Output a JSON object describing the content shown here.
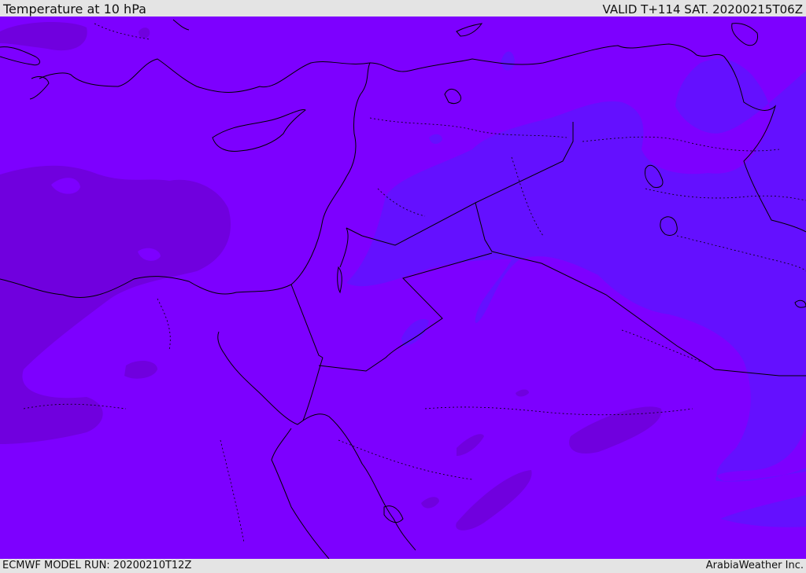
{
  "header": {
    "title": "Temperature at 10 hPa",
    "valid": "VALID T+114 SAT. 20200215T06Z"
  },
  "footer": {
    "model_run": "ECMWF MODEL RUN: 20200210T12Z",
    "credit": "ArabiaWeather Inc."
  },
  "map": {
    "type": "temperature-field",
    "level": "10 hPa",
    "colors": {
      "base": "#7d00ff",
      "warm": "#7000de",
      "cool": "#6410ff",
      "coast": "#000000"
    }
  }
}
